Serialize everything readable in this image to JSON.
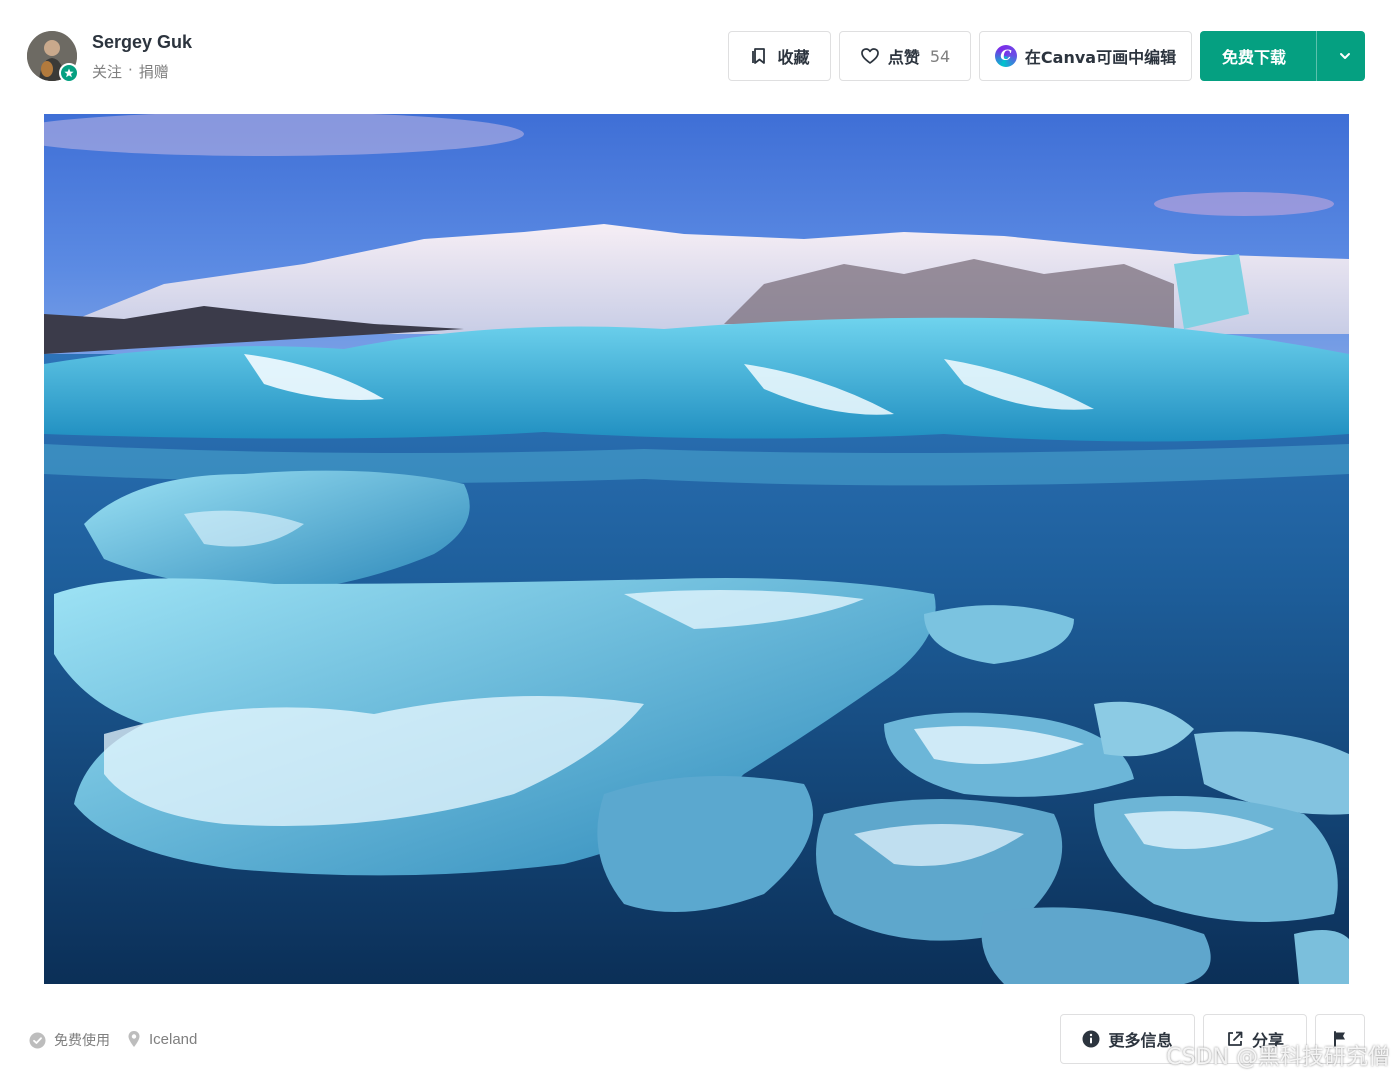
{
  "author": {
    "name": "Sergey Guk",
    "follow_label": "关注",
    "separator": "·",
    "donate_label": "捐赠"
  },
  "toolbar": {
    "bookmark_label": "收藏",
    "like_label": "点赞",
    "like_count": "54",
    "canva_label": "在Canva可画中编辑",
    "download_label": "免费下载"
  },
  "photo": {
    "subject": "Glacier lagoon with icebergs and snowy mountains at dusk"
  },
  "footer": {
    "license_label": "免费使用",
    "location_label": "Iceland",
    "more_info_label": "更多信息",
    "share_label": "分享"
  },
  "watermark": "CSDN @黑科技研究僧",
  "colors": {
    "accent": "#05a081",
    "text": "#2c343e",
    "muted": "#7f7f7f",
    "border": "#dfdfe0"
  }
}
